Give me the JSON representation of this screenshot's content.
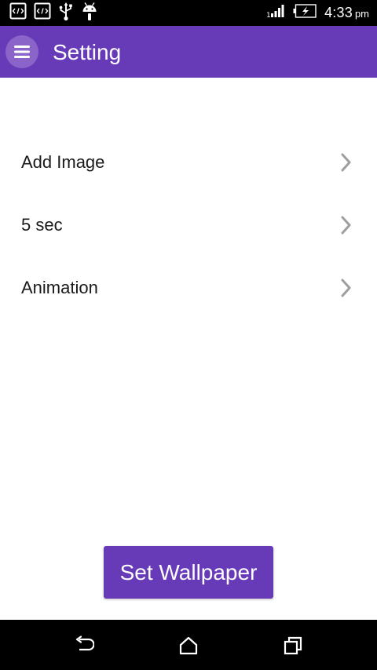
{
  "status_bar": {
    "icons_left": [
      "code-notification-icon",
      "code-notification-icon",
      "usb-icon",
      "android-debug-icon"
    ],
    "icons_right": [
      "signal-icon",
      "battery-charging-icon"
    ],
    "time": "4:33",
    "ampm": "pm"
  },
  "app_bar": {
    "title": "Setting",
    "menu_icon": "hamburger-menu-icon",
    "color": "#673AB7"
  },
  "settings": {
    "items": [
      {
        "label": "Add Image"
      },
      {
        "label": "5 sec"
      },
      {
        "label": "Animation"
      }
    ]
  },
  "actions": {
    "set_wallpaper_label": "Set Wallpaper"
  },
  "nav_bar": {
    "icons": [
      "back-icon",
      "home-icon",
      "recent-apps-icon"
    ]
  }
}
